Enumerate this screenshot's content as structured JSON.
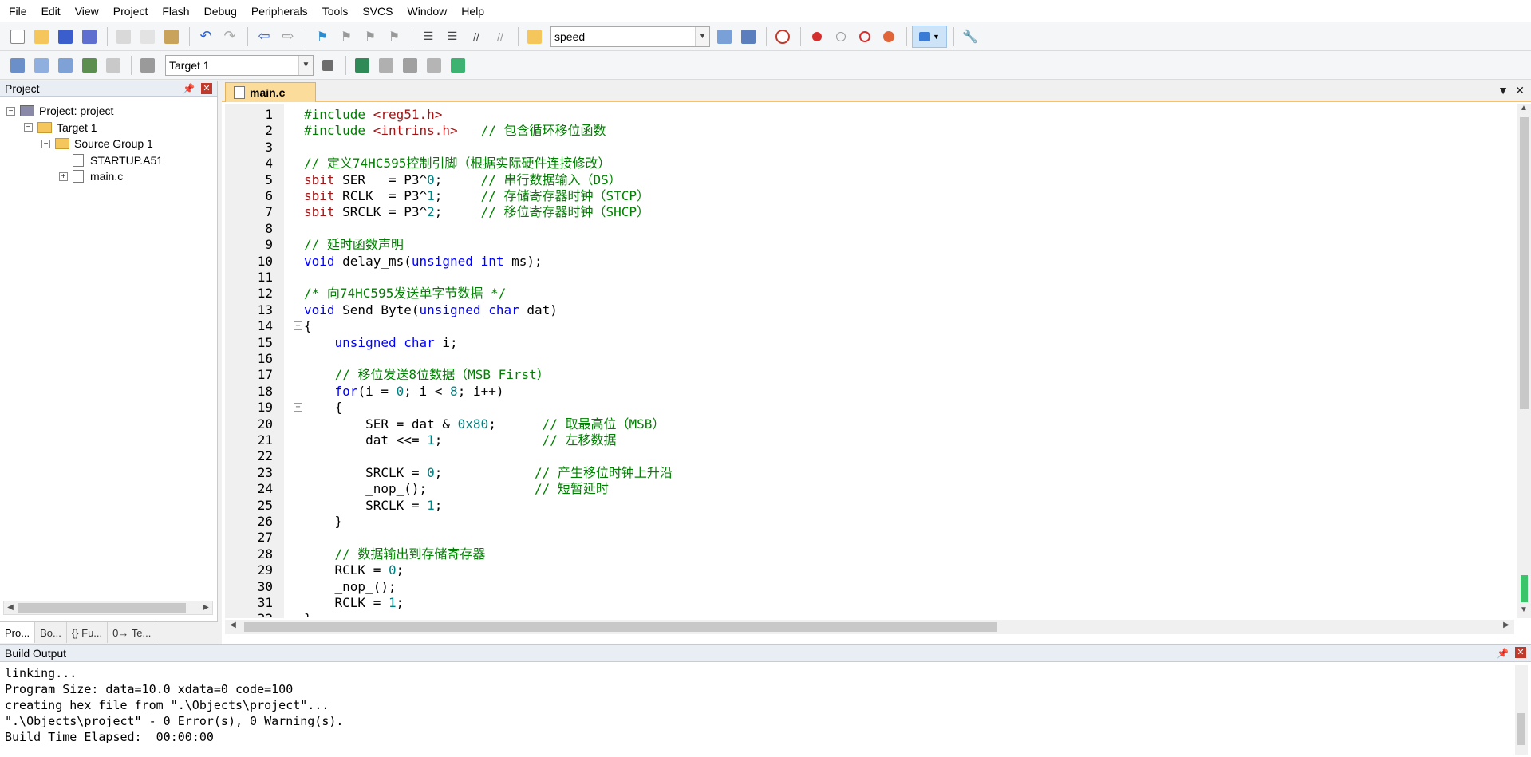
{
  "menu": [
    "File",
    "Edit",
    "View",
    "Project",
    "Flash",
    "Debug",
    "Peripherals",
    "Tools",
    "SVCS",
    "Window",
    "Help"
  ],
  "toolbar1": {
    "find_combo_value": "speed"
  },
  "toolbar2": {
    "target_combo_value": "Target 1"
  },
  "project_panel": {
    "title": "Project",
    "tree": [
      {
        "label": "Project: project",
        "level": 0,
        "expander": "−",
        "icon": "project-icon"
      },
      {
        "label": "Target 1",
        "level": 1,
        "expander": "−",
        "icon": "target-icon"
      },
      {
        "label": "Source Group 1",
        "level": 2,
        "expander": "−",
        "icon": "folder-icon"
      },
      {
        "label": "STARTUP.A51",
        "level": 3,
        "expander": "",
        "icon": "file-icon"
      },
      {
        "label": "main.c",
        "level": 3,
        "expander": "+",
        "icon": "file-icon"
      }
    ],
    "tabs": [
      "Pro...",
      "Bo...",
      "{} Fu...",
      "0→ Te..."
    ]
  },
  "editor": {
    "active_tab": "main.c",
    "lines": [
      "#include <reg51.h>",
      "#include <intrins.h>   // 包含循环移位函数",
      "",
      "// 定义74HC595控制引脚（根据实际硬件连接修改）",
      "sbit SER   = P3^0;     // 串行数据输入（DS）",
      "sbit RCLK  = P3^1;     // 存储寄存器时钟（STCP）",
      "sbit SRCLK = P3^2;     // 移位寄存器时钟（SHCP）",
      "",
      "// 延时函数声明",
      "void delay_ms(unsigned int ms);",
      "",
      "/* 向74HC595发送单字节数据 */",
      "void Send_Byte(unsigned char dat)",
      "{",
      "    unsigned char i;",
      "",
      "    // 移位发送8位数据（MSB First）",
      "    for(i = 0; i < 8; i++)",
      "    {",
      "        SER = dat & 0x80;      // 取最高位（MSB）",
      "        dat <<= 1;             // 左移数据",
      "",
      "        SRCLK = 0;            // 产生移位时钟上升沿",
      "        _nop_();              // 短暂延时",
      "        SRCLK = 1;",
      "    }",
      "",
      "    // 数据输出到存储寄存器",
      "    RCLK = 0;",
      "    _nop_();",
      "    RCLK = 1;",
      "}"
    ],
    "fold_lines": [
      14,
      19
    ]
  },
  "build_output": {
    "title": "Build Output",
    "lines": [
      "linking...",
      "Program Size: data=10.0 xdata=0 code=100",
      "creating hex file from \".\\Objects\\project\"...",
      "\".\\Objects\\project\" - 0 Error(s), 0 Warning(s).",
      "Build Time Elapsed:  00:00:00"
    ]
  }
}
